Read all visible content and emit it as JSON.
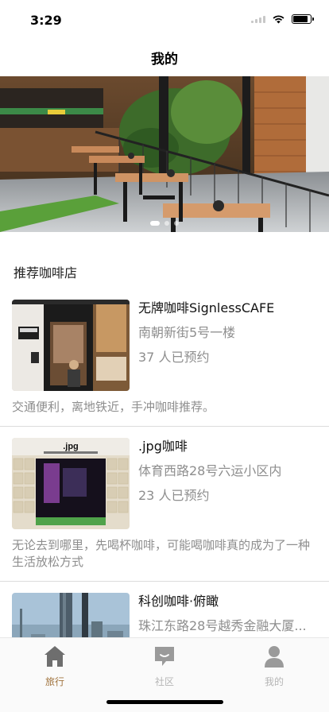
{
  "status_bar": {
    "time": "3:29",
    "battery_level": 0.85
  },
  "header": {
    "title": "我的"
  },
  "hero": {
    "image": "cafe-interior-photo",
    "slides": 3,
    "active_slide": 0
  },
  "section": {
    "title": "推荐咖啡店"
  },
  "shops": [
    {
      "name": "无牌咖啡SignlessCAFE",
      "address": "南朝新街5号一楼",
      "bookings": "37 人已预约",
      "description": "交通便利，离地铁近，手冲咖啡推荐。",
      "image": "storefront-photo"
    },
    {
      "name": ".jpg咖啡",
      "address": "体育西路28号六运小区内",
      "bookings": "23 人已预约",
      "description": "无论去到哪里，先喝杯咖啡，可能喝咖啡真的成为了一种生活放松方式",
      "image": "jpg-cafe-photo"
    },
    {
      "name": "科创咖啡·俯瞰",
      "address": "珠江东路28号越秀金融大厦...",
      "bookings": "",
      "description": "",
      "image": "city-skyline-photo"
    }
  ],
  "tabbar": {
    "items": [
      {
        "label": "旅行",
        "icon": "home-icon",
        "active": true
      },
      {
        "label": "社区",
        "icon": "chat-icon",
        "active": false
      },
      {
        "label": "我的",
        "icon": "person-icon",
        "active": false
      }
    ],
    "active_color": "#a0733d",
    "inactive_color": "#b5b5b5"
  }
}
